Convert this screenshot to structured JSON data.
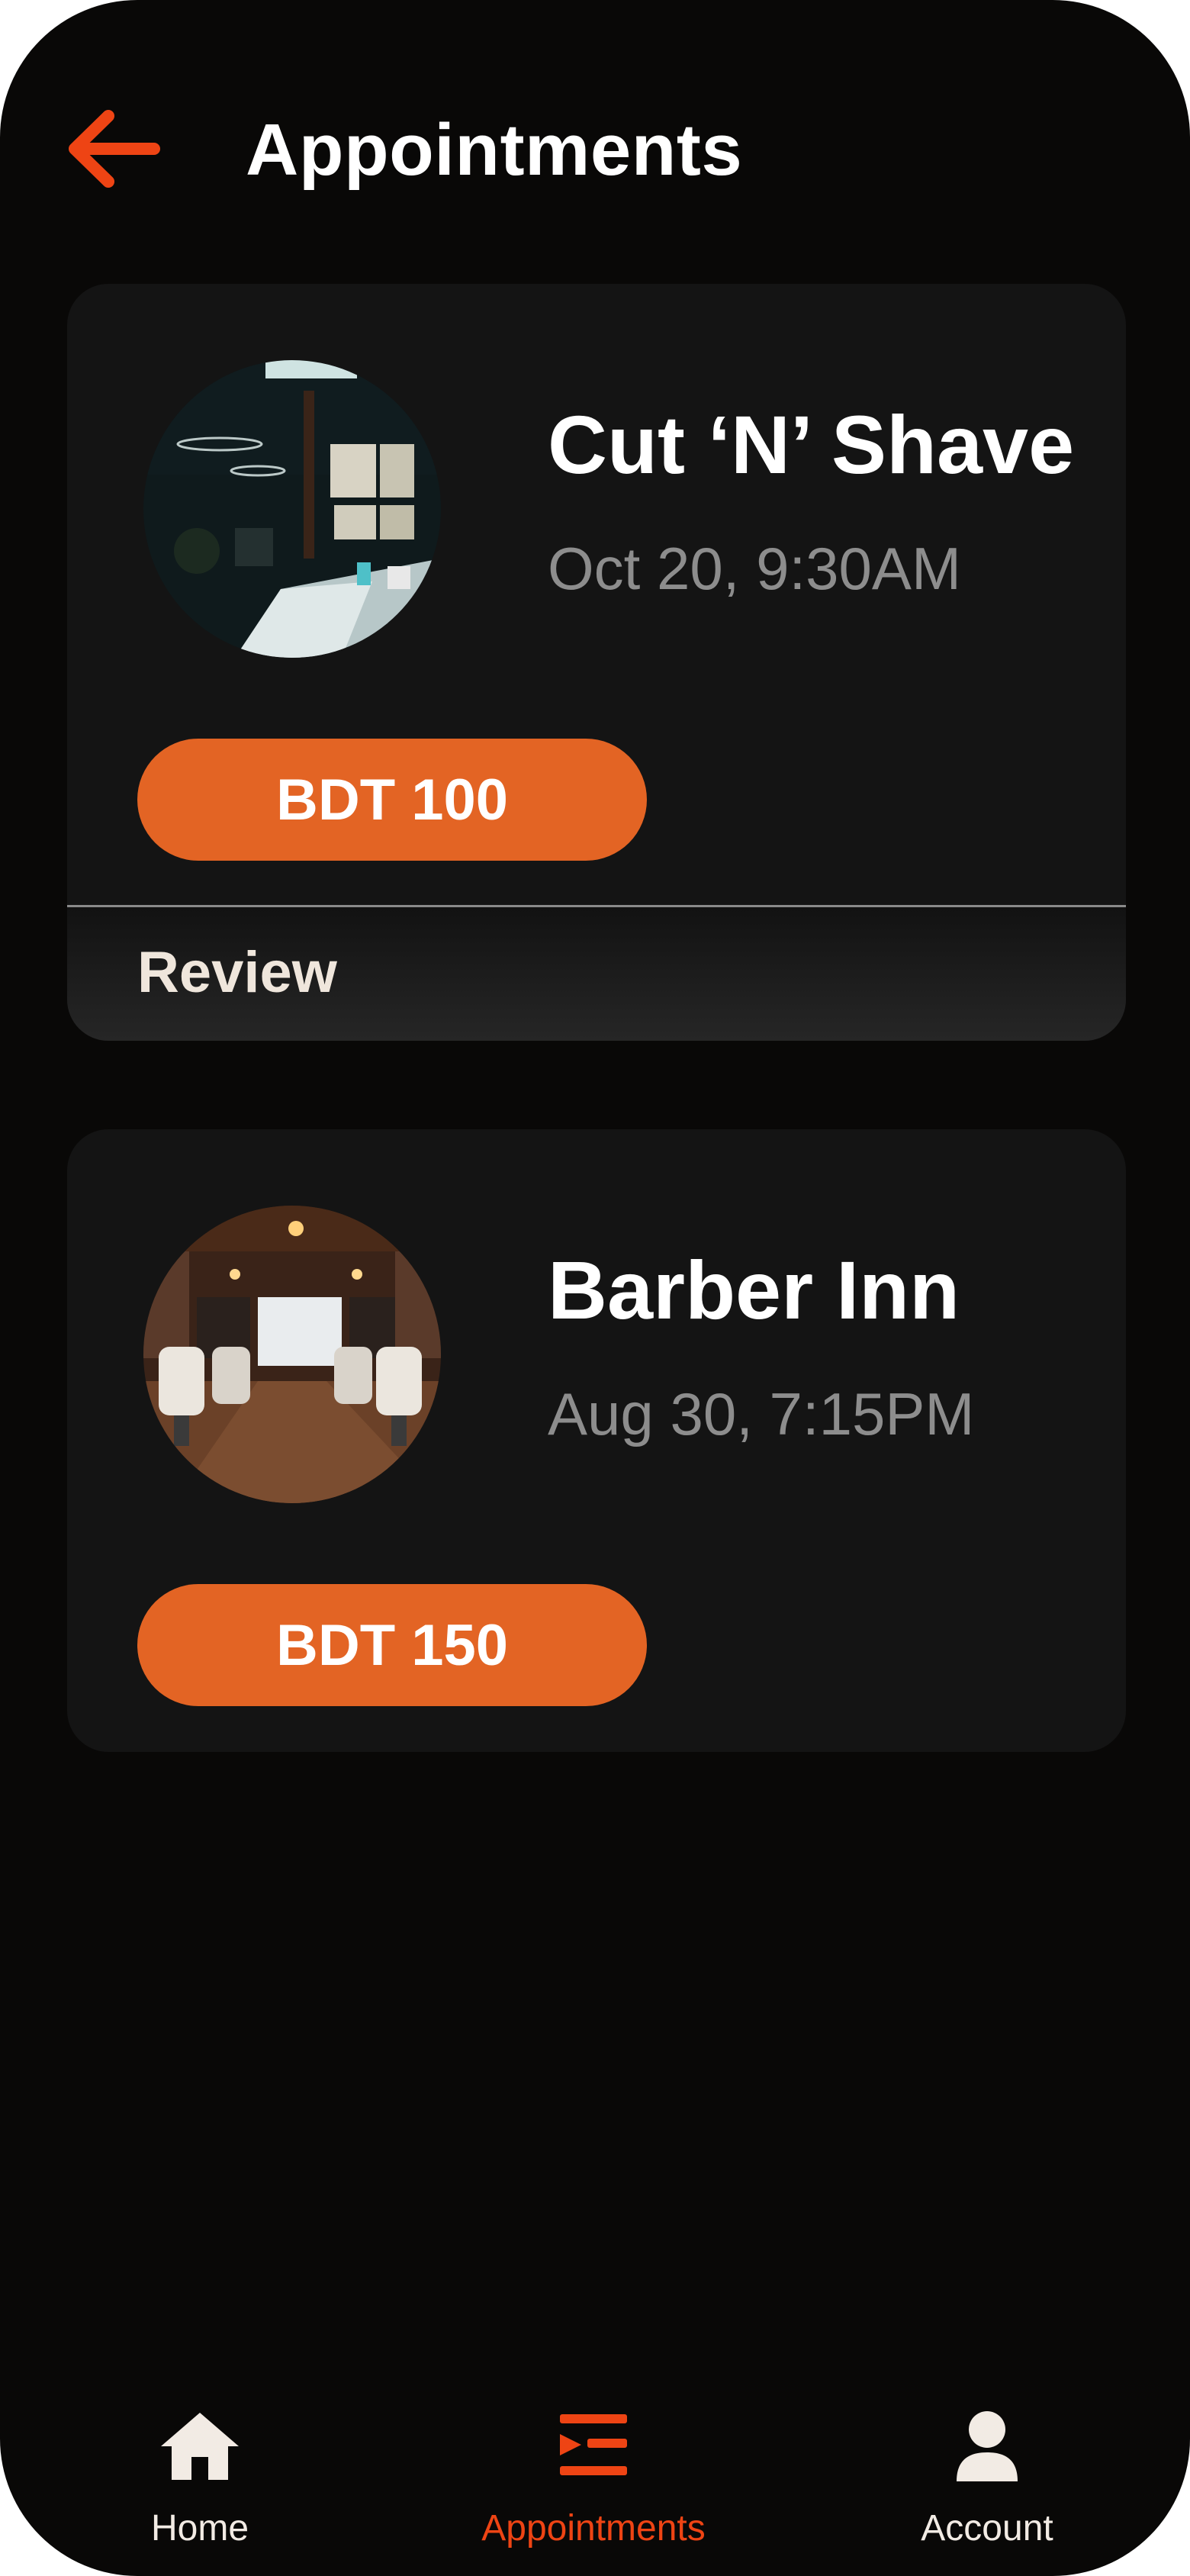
{
  "header": {
    "title": "Appointments",
    "back_icon": "arrow-left-icon",
    "accent_color": "#ee4414"
  },
  "appointments": [
    {
      "shop_name": "Cut ‘N’ Shave",
      "datetime": "Oct 20, 9:30AM",
      "price": "BDT 100",
      "action_label": "Review"
    },
    {
      "shop_name": "Barber Inn",
      "datetime": "Aug 30, 7:15PM",
      "price": "BDT 150"
    }
  ],
  "nav": {
    "items": [
      {
        "label": "Home",
        "icon": "home-icon",
        "active": false
      },
      {
        "label": "Appointments",
        "icon": "appointments-list-icon",
        "active": true
      },
      {
        "label": "Account",
        "icon": "user-icon",
        "active": false
      }
    ],
    "active_color": "#ee4414",
    "inactive_color": "#f2ebe4"
  },
  "colors": {
    "background": "#090807",
    "card": "#141414",
    "price_pill": "#e36424",
    "muted_text": "#8d8d8d"
  }
}
